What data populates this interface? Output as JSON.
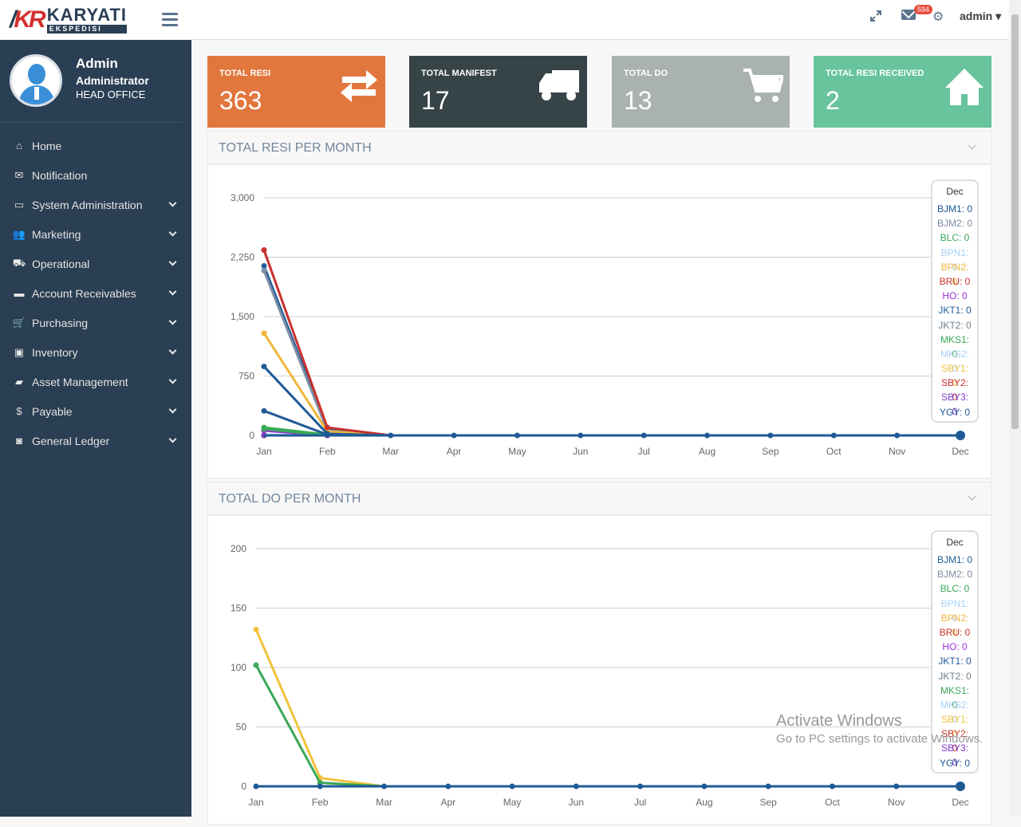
{
  "brand": {
    "mark": "KR",
    "name": "KARYATI",
    "sub": "EKSPEDISI"
  },
  "profile": {
    "name": "Admin",
    "role": "Administrator",
    "office": "HEAD OFFICE"
  },
  "menu": [
    {
      "label": "Home",
      "icon": "home-icon",
      "expandable": false
    },
    {
      "label": "Notification",
      "icon": "envelope-icon",
      "expandable": false
    },
    {
      "label": "System Administration",
      "icon": "laptop-icon",
      "expandable": true
    },
    {
      "label": "Marketing",
      "icon": "users-icon",
      "expandable": true
    },
    {
      "label": "Operational",
      "icon": "truck-icon",
      "expandable": true
    },
    {
      "label": "Account Receivables",
      "icon": "credit-card-icon",
      "expandable": true
    },
    {
      "label": "Purchasing",
      "icon": "cart-icon",
      "expandable": true
    },
    {
      "label": "Inventory",
      "icon": "briefcase-icon",
      "expandable": true
    },
    {
      "label": "Asset Management",
      "icon": "folder-icon",
      "expandable": true
    },
    {
      "label": "Payable",
      "icon": "dollar-icon",
      "expandable": true
    },
    {
      "label": "General Ledger",
      "icon": "money-icon",
      "expandable": true
    }
  ],
  "topbar": {
    "badge": "594",
    "user": "admin"
  },
  "tiles": [
    {
      "label": "TOTAL RESI",
      "value": "363",
      "color": "#e2773e",
      "icon": "exchange-icon"
    },
    {
      "label": "TOTAL MANIFEST",
      "value": "17",
      "color": "#364347",
      "icon": "truck-icon"
    },
    {
      "label": "TOTAL DO",
      "value": "13",
      "color": "#a9b2b0",
      "icon": "cart-icon"
    },
    {
      "label": "TOTAL RESI RECEIVED",
      "value": "2",
      "color": "#67c49c",
      "icon": "home-icon"
    }
  ],
  "panels": {
    "resi_title": "TOTAL RESI PER MONTH",
    "do_title": "TOTAL DO PER MONTH"
  },
  "legend_colors": [
    "#1f5a96",
    "#7f8fa6",
    "#3aa757",
    "#a9d0f5",
    "#f0b63c",
    "#c9302c",
    "#9b30d9",
    "#1f5a96",
    "#6d7d8b",
    "#3aa757",
    "#a9d0f5",
    "#f0c23c",
    "#c9302c",
    "#7c3cc9",
    "#1f5a96"
  ],
  "chart_data": [
    {
      "type": "line",
      "x": [
        "Jan",
        "Feb",
        "Mar",
        "Apr",
        "May",
        "Jun",
        "Jul",
        "Aug",
        "Sep",
        "Oct",
        "Nov",
        "Dec"
      ],
      "yticks": [
        "0",
        "750",
        "1,500",
        "2,250",
        "3,000"
      ],
      "ylim": [
        0,
        3000
      ],
      "tooltip": {
        "title": "Dec",
        "lines": [
          "BJM1: 0",
          "BJM2: 0",
          "BLC: 0",
          "BPN1: 0",
          "BPN2: 0",
          "BRU: 0",
          "HO: 0",
          "JKT1: 0",
          "JKT2: 0",
          "MKS1: 0",
          "MKS2: 0",
          "SBY1: 0",
          "SBY2: 0",
          "SBY3: 0",
          "YGY: 0"
        ]
      },
      "series": [
        {
          "name": "BJM1",
          "color": "#1f5a96",
          "values": [
            2140,
            90,
            0,
            0,
            0,
            0,
            0,
            0,
            0,
            0,
            0,
            0
          ]
        },
        {
          "name": "BJM2",
          "color": "#7f8fa6",
          "values": [
            2080,
            60,
            0,
            0,
            0,
            0,
            0,
            0,
            0,
            0,
            0,
            0
          ]
        },
        {
          "name": "BLC",
          "color": "#3aa757",
          "values": [
            100,
            10,
            0,
            0,
            0,
            0,
            0,
            0,
            0,
            0,
            0,
            0
          ]
        },
        {
          "name": "BPN1",
          "color": "#a9d0f5",
          "values": [
            10,
            0,
            0,
            0,
            0,
            0,
            0,
            0,
            0,
            0,
            0,
            0
          ]
        },
        {
          "name": "BPN2",
          "color": "#f0b63c",
          "values": [
            1290,
            50,
            0,
            0,
            0,
            0,
            0,
            0,
            0,
            0,
            0,
            0
          ]
        },
        {
          "name": "BRU",
          "color": "#c9302c",
          "values": [
            2340,
            100,
            0,
            0,
            0,
            0,
            0,
            0,
            0,
            0,
            0,
            0
          ]
        },
        {
          "name": "HO",
          "color": "#9b30d9",
          "values": [
            60,
            0,
            0,
            0,
            0,
            0,
            0,
            0,
            0,
            0,
            0,
            0
          ]
        },
        {
          "name": "JKT1",
          "color": "#1f5a96",
          "values": [
            870,
            20,
            0,
            0,
            0,
            0,
            0,
            0,
            0,
            0,
            0,
            0
          ]
        },
        {
          "name": "JKT2",
          "color": "#6d7d8b",
          "values": [
            0,
            0,
            0,
            0,
            0,
            0,
            0,
            0,
            0,
            0,
            0,
            0
          ]
        },
        {
          "name": "MKS1",
          "color": "#3aa757",
          "values": [
            80,
            0,
            0,
            0,
            0,
            0,
            0,
            0,
            0,
            0,
            0,
            0
          ]
        },
        {
          "name": "MKS2",
          "color": "#a9d0f5",
          "values": [
            0,
            0,
            0,
            0,
            0,
            0,
            0,
            0,
            0,
            0,
            0,
            0
          ]
        },
        {
          "name": "SBY1",
          "color": "#f0c23c",
          "values": [
            0,
            0,
            0,
            0,
            0,
            0,
            0,
            0,
            0,
            0,
            0,
            0
          ]
        },
        {
          "name": "SBY2",
          "color": "#c9302c",
          "values": [
            0,
            0,
            0,
            0,
            0,
            0,
            0,
            0,
            0,
            0,
            0,
            0
          ]
        },
        {
          "name": "SBY3",
          "color": "#7c3cc9",
          "values": [
            0,
            0,
            0,
            0,
            0,
            0,
            0,
            0,
            0,
            0,
            0,
            0
          ]
        },
        {
          "name": "YGY",
          "color": "#1f5a96",
          "values": [
            310,
            10,
            0,
            0,
            0,
            0,
            0,
            0,
            0,
            0,
            0,
            0
          ]
        }
      ]
    },
    {
      "type": "line",
      "x": [
        "Jan",
        "Feb",
        "Mar",
        "Apr",
        "May",
        "Jun",
        "Jul",
        "Aug",
        "Sep",
        "Oct",
        "Nov",
        "Dec"
      ],
      "yticks": [
        "0",
        "50",
        "100",
        "150",
        "200"
      ],
      "ylim": [
        0,
        200
      ],
      "tooltip": {
        "title": "Dec",
        "lines": [
          "BJM1: 0",
          "BJM2: 0",
          "BLC: 0",
          "BPN1: 0",
          "BPN2: 0",
          "BRU: 0",
          "HO: 0",
          "JKT1: 0",
          "JKT2: 0",
          "MKS1: 0",
          "MKS2: 0",
          "SBY1: 0",
          "SBY2: 0",
          "SBY3: 0",
          "YGY: 0"
        ]
      },
      "series": [
        {
          "name": "BPN2",
          "color": "#f0c23c",
          "values": [
            132,
            7,
            0,
            0,
            0,
            0,
            0,
            0,
            0,
            0,
            0,
            0
          ]
        },
        {
          "name": "BLC",
          "color": "#3aa757",
          "values": [
            102,
            3,
            0,
            0,
            0,
            0,
            0,
            0,
            0,
            0,
            0,
            0
          ]
        },
        {
          "name": "BJM1",
          "color": "#1f5a96",
          "values": [
            0,
            0,
            0,
            0,
            0,
            0,
            0,
            0,
            0,
            0,
            0,
            0
          ]
        }
      ]
    }
  ],
  "watermark": {
    "line1": "Activate Windows",
    "line2": "Go to PC settings to activate Windows."
  }
}
